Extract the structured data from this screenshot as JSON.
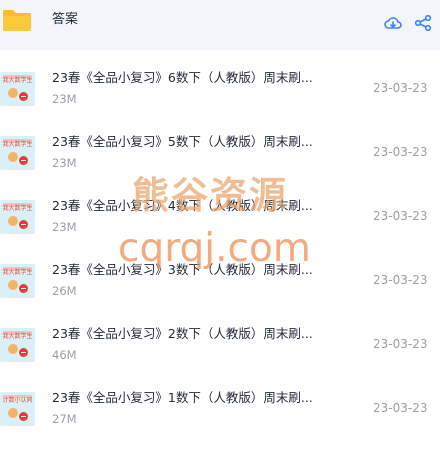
{
  "folder": {
    "name": "答案",
    "icon": "folder-icon"
  },
  "header_actions": [
    {
      "name": "cloud-download-icon",
      "color": "#3b82f6"
    },
    {
      "name": "share-icon",
      "color": "#3b82f6"
    }
  ],
  "files": [
    {
      "name": "23春《全品小复习》6数下（人教版）周末刷...",
      "size": "23M",
      "date": "23-03-23",
      "thumb_text": "我大数学生"
    },
    {
      "name": "23春《全品小复习》5数下（人教版）周末刷...",
      "size": "23M",
      "date": "23-03-23",
      "thumb_text": "我大数学生"
    },
    {
      "name": "23春《全品小复习》4数下（人教版）周末刷...",
      "size": "23M",
      "date": "23-03-23",
      "thumb_text": "我大数学生"
    },
    {
      "name": "23春《全品小复习》3数下（人教版）周末刷...",
      "size": "26M",
      "date": "23-03-23",
      "thumb_text": "我大数学生"
    },
    {
      "name": "23春《全品小复习》2数下（人教版）周末刷...",
      "size": "46M",
      "date": "23-03-23",
      "thumb_text": "我大数学生"
    },
    {
      "name": "23春《全品小复习》1数下（人教版）周末刷...",
      "size": "27M",
      "date": "23-03-23",
      "thumb_text": "计数小认同"
    }
  ],
  "watermark": {
    "line1": "熊谷资源",
    "line2": "cqrqj.com"
  },
  "colors": {
    "header_bg": "#f3f5fa",
    "accent": "#3b82f6",
    "folder": "#fbbf24",
    "muted_text": "#9aa0a6"
  }
}
